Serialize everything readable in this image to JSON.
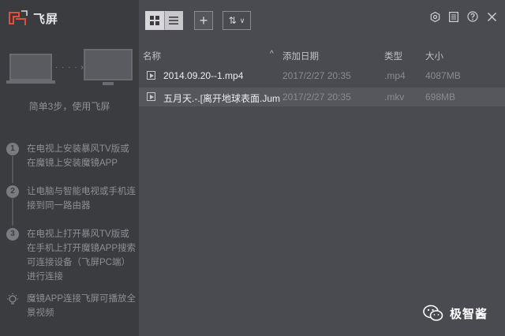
{
  "app": {
    "title": "飞屏"
  },
  "sidebar": {
    "steps_title": "简单3步，使用飞屏",
    "steps": [
      {
        "num": "1",
        "text": "在电视上安装暴风TV版或在魔镜上安装魔镜APP"
      },
      {
        "num": "2",
        "text": "让电脑与智能电视或手机连接到同一路由器"
      },
      {
        "num": "3",
        "text": "在电视上打开暴风TV版或在手机上打开魔镜APP搜索可连接设备（飞屏PC端）进行连接"
      }
    ],
    "tip": "魔镜APP连接飞屏可播放全景视频",
    "transfer_dots": "· · · · ›"
  },
  "toolbar": {
    "grid_view": "grid-view",
    "list_view": "list-view",
    "add_label": "+",
    "sort_label": "⇅",
    "sort_caret": "∨"
  },
  "window_controls": [
    "settings-icon",
    "menu-icon",
    "help-icon",
    "close-icon"
  ],
  "table": {
    "columns": {
      "name": "名称",
      "date": "添加日期",
      "type": "类型",
      "size": "大小"
    },
    "sort_indicator": "^",
    "rows": [
      {
        "name": "2014.09.20--1.mp4",
        "date": "2017/2/27 20:35",
        "type": ".mp4",
        "size": "4087MB"
      },
      {
        "name": "五月天.-.[离开地球表面.Jump",
        "date": "2017/2/27 20:35",
        "type": ".mkv",
        "size": "698MB"
      }
    ]
  },
  "watermark": {
    "text": "极智酱"
  },
  "colors": {
    "sidebar_bg": "#3b3c40",
    "main_bg": "#4a4b50",
    "selected_row": "#56575c"
  }
}
